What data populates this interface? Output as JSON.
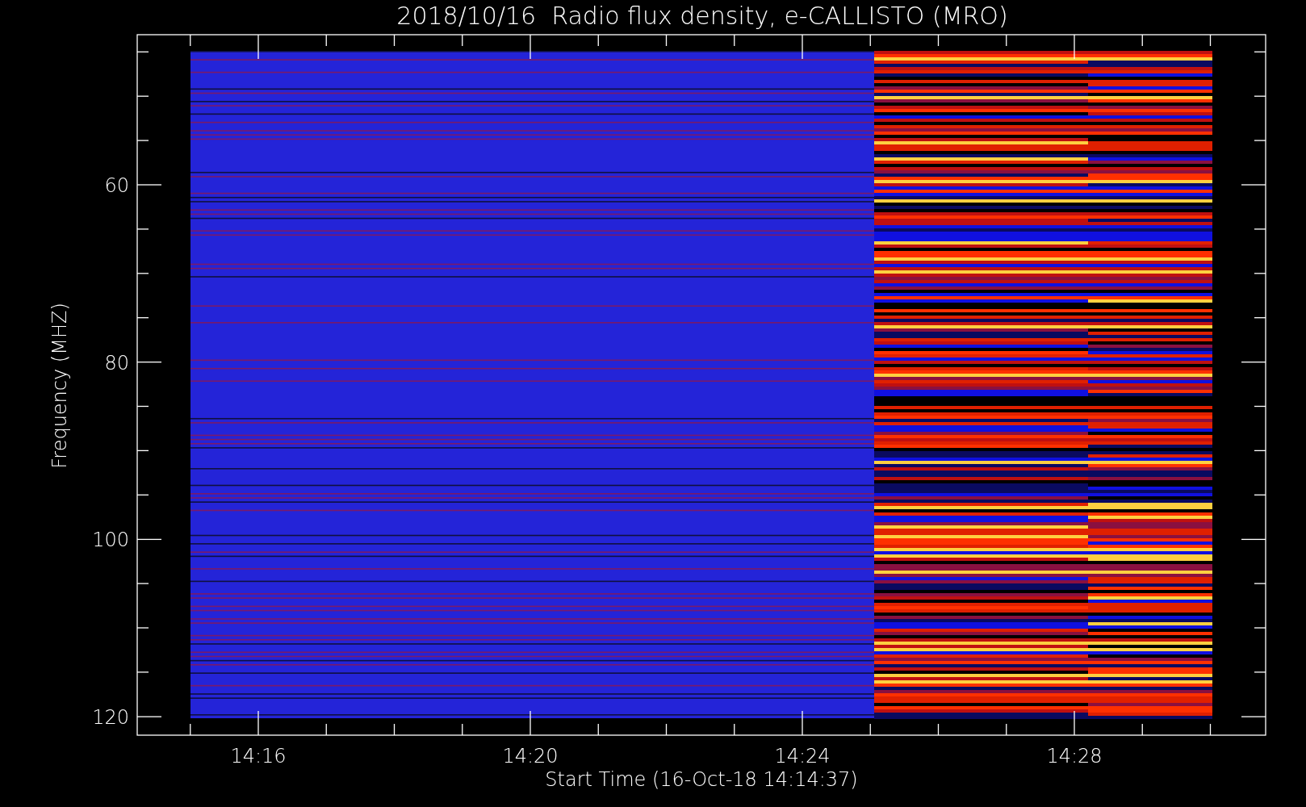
{
  "title": "2018/10/16  Radio flux density, e-CALLISTO (MRO)",
  "y_axis": {
    "label": "Frequency (MHZ)",
    "ticks": [
      "60",
      "80",
      "100",
      "120"
    ]
  },
  "x_axis": {
    "label": "Start Time (16-Oct-18 14:14:37)",
    "ticks": [
      "14:16",
      "14:20",
      "14:24",
      "14:28"
    ]
  }
}
